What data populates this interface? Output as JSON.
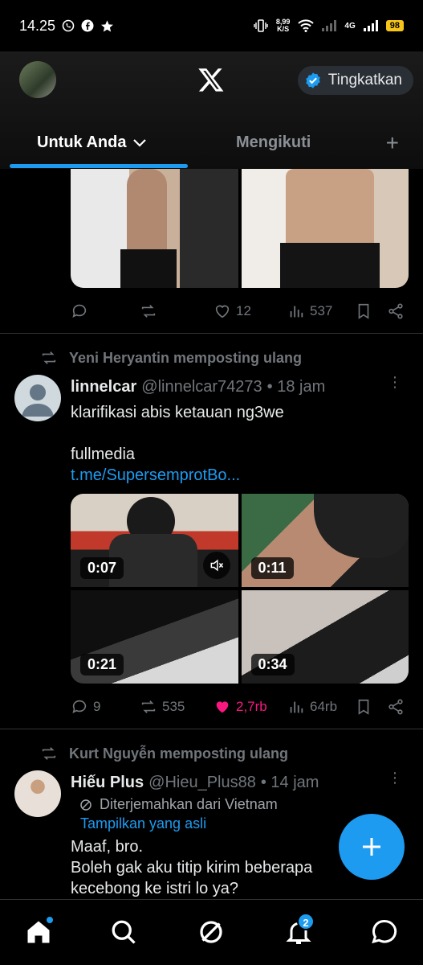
{
  "status_bar": {
    "time": "14.25",
    "net_speed_value": "8,99",
    "net_speed_unit": "K/S",
    "network": "4G",
    "battery": "98"
  },
  "header": {
    "upgrade_label": "Tingkatkan",
    "tabs": [
      {
        "label": "Untuk Anda",
        "active": true
      },
      {
        "label": "Mengikuti",
        "active": false
      }
    ]
  },
  "post1": {
    "replies": "",
    "reposts": "",
    "likes": "12",
    "views": "537"
  },
  "post2": {
    "reposted_by": "Yeni Heryantin memposting ulang",
    "name": "linnelcar",
    "handle": "@linnelcar74273",
    "time": "• 18 jam",
    "text_line1": "klarifikasi abis ketauan ng3we",
    "text_line2": "fullmedia",
    "link": "t.me/SupersemprotBo...",
    "media_durations": [
      "0:07",
      "0:11",
      "0:21",
      "0:34"
    ],
    "replies": "9",
    "reposts": "535",
    "likes": "2,7rb",
    "views": "64rb",
    "like_color": "#f91880"
  },
  "post3": {
    "reposted_by": "Kurt Nguyễn memposting ulang",
    "name": "Hiếu Plus",
    "handle": "@Hieu_Plus88",
    "time": "• 14 jam",
    "translated": "Diterjemahkan dari Vietnam",
    "show_original": "Tampilkan yang asli",
    "text_line1": "Maaf, bro.",
    "text_line2": "Boleh gak aku titip kirim beberapa",
    "text_line3": "kecebong ke istri lo ya?"
  },
  "bottom_nav": {
    "notifications_badge": "2"
  },
  "colors": {
    "accent": "#1d9bf0",
    "like": "#f91880",
    "muted": "#71767b"
  }
}
